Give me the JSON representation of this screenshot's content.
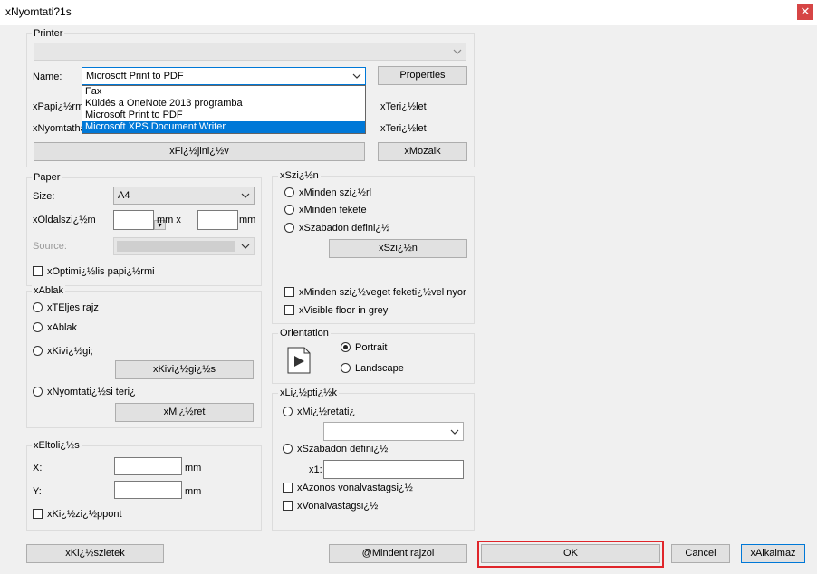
{
  "window": {
    "title": "xNyomtati?1s",
    "close_label": "✕"
  },
  "printer": {
    "group_label": "Printer",
    "name_label": "Name:",
    "name_value": "Microsoft Print to PDF",
    "properties_label": "Properties",
    "paper_label_partial": "xPapi¿½rmi",
    "printer_label_partial": "xNyomtatha",
    "area_label_1": "xTeri¿½let",
    "area_label_2": "xTeri¿½let",
    "fit_button": "xFi¿½jlni¿½v",
    "mosaic_button": "xMozaik",
    "dropdown_items": [
      "Fax",
      "Küldés a OneNote 2013 programba",
      "Microsoft Print to PDF",
      "Microsoft XPS Document Writer"
    ]
  },
  "paper": {
    "group_label": "Paper",
    "size_label": "Size:",
    "size_value": "A4",
    "side_label": "xOldalszi¿½m",
    "mm1": "mm x",
    "mm2": "mm",
    "source_label": "Source:",
    "optimal_label": "xOptimi¿½lis papi¿½rmi"
  },
  "window_group": {
    "group_label": "xAblak",
    "full_drawing": "xTEljes rajz",
    "window": "xAblak",
    "view": "xKivi¿½gi;",
    "view_button": "xKivi¿½gi¿½s",
    "print_area": "xNyomtati¿½si teri¿",
    "size_button": "xMi¿½ret"
  },
  "offset": {
    "group_label": "xEltoli¿½s",
    "x_label": "X:",
    "y_label": "Y:",
    "x_unit": "mm",
    "y_unit": "mm",
    "center_label": "xKi¿½zi¿½ppont"
  },
  "color": {
    "group_label": "xSzi¿½n",
    "all_color": "xMinden szi¿½rl",
    "all_black": "xMinden fekete",
    "free": "xSzabadon defini¿½",
    "color_button": "xSzi¿½n",
    "all_colors_black": "xMinden szi¿½veget feketi¿½vel nyor",
    "visible_floor": "xVisible floor in grey"
  },
  "orientation": {
    "group_label": "Orientation",
    "portrait": "Portrait",
    "landscape": "Landscape"
  },
  "lines": {
    "group_label": "xLi¿½pti¿½k",
    "size_option": "xMi¿½retati¿",
    "free_option": "xSzabadon defini¿½",
    "x1_label": "x1:",
    "same_width": "xAzonos vonalvastagsi¿½",
    "line_width": "xVonalvastagsi¿½"
  },
  "footer": {
    "details": "xKi¿½szletek",
    "all_drawing": "@Mindent rajzol",
    "ok": "OK",
    "cancel": "Cancel",
    "apply": "xAlkalmaz"
  }
}
